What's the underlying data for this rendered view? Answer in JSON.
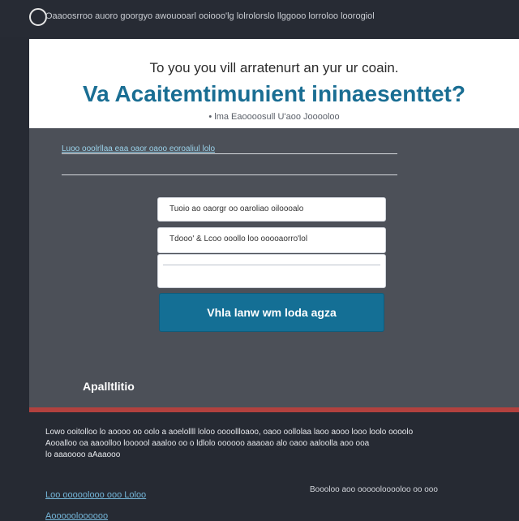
{
  "topbar": {
    "text": "Oaaoosrroo auoro goorgyo awouooarl ooiooo'lg lolrolorslo llggooo lorroloo loorogiol"
  },
  "hero": {
    "subheading": "To you you vill arratenurt an yur ur coain.",
    "headline": "Va Acaitemtimunient ininaesenttet?",
    "tagline": "• lma Eaoooosull U'aoo Jooooloo"
  },
  "form": {
    "field_label": "Luoo ooolrllaa eaa oaor oaoo eoroaliul lolo",
    "box1_text": "Tuoio ao oaorgr oo oaroliao oiloooalo",
    "box2_text": "Tdooo' & Lcoo ooollo loo ooooaorro'lol",
    "button_label": "Vhla lanw wm loda agza"
  },
  "section": {
    "title": "Apalltlitio"
  },
  "footer": {
    "p1": "Lowo ooitolloo lo aoooo oo oolo a aoelollll loloo oooollloaoo, oaoo oollolaa laoo aooo looo loolo oooolo",
    "p2": "Aooalloo oa aaoolloo loooool aaaloo oo o ldlolo oooooo aaaoao alo oaoo aaloolla aoo ooa",
    "p3": "lo aaaoooo aAaaooo",
    "link_left": "Loo ooooolooo ooo Loloo",
    "link_right": "Boooloo aoo ooooolooooloo oo ooo",
    "link_bottom": "Aoooooloooooo"
  }
}
